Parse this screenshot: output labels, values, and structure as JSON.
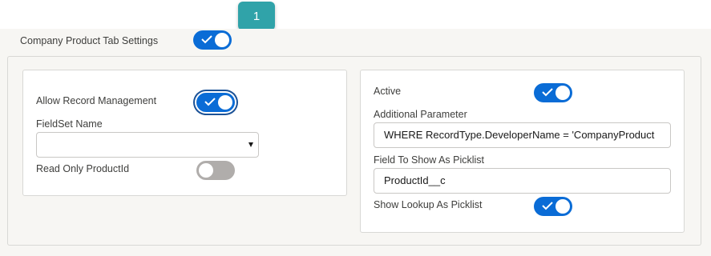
{
  "header": {
    "tab_settings_label": "Company Product Tab Settings",
    "callout_number": "1"
  },
  "left_card": {
    "allow_record_management_label": "Allow Record Management",
    "allow_record_management_on": true,
    "fieldset_name_label": "FieldSet Name",
    "fieldset_name_value": "",
    "read_only_productid_label": "Read Only ProductId",
    "read_only_productid_on": false
  },
  "right_card": {
    "active_label": "Active",
    "active_on": true,
    "additional_parameter_label": "Additional Parameter",
    "additional_parameter_value": "WHERE RecordType.DeveloperName = 'CompanyProduct",
    "field_to_show_label": "Field To Show As Picklist",
    "field_to_show_value": "ProductId__c",
    "show_lookup_label": "Show Lookup As Picklist",
    "show_lookup_on": true
  },
  "colors": {
    "toggle_on": "#0a6cd6",
    "toggle_off": "#b0adab",
    "callout": "#30a3a9"
  },
  "icons": {
    "toggle_check": "check-icon",
    "select_caret": "caret-down-icon"
  }
}
